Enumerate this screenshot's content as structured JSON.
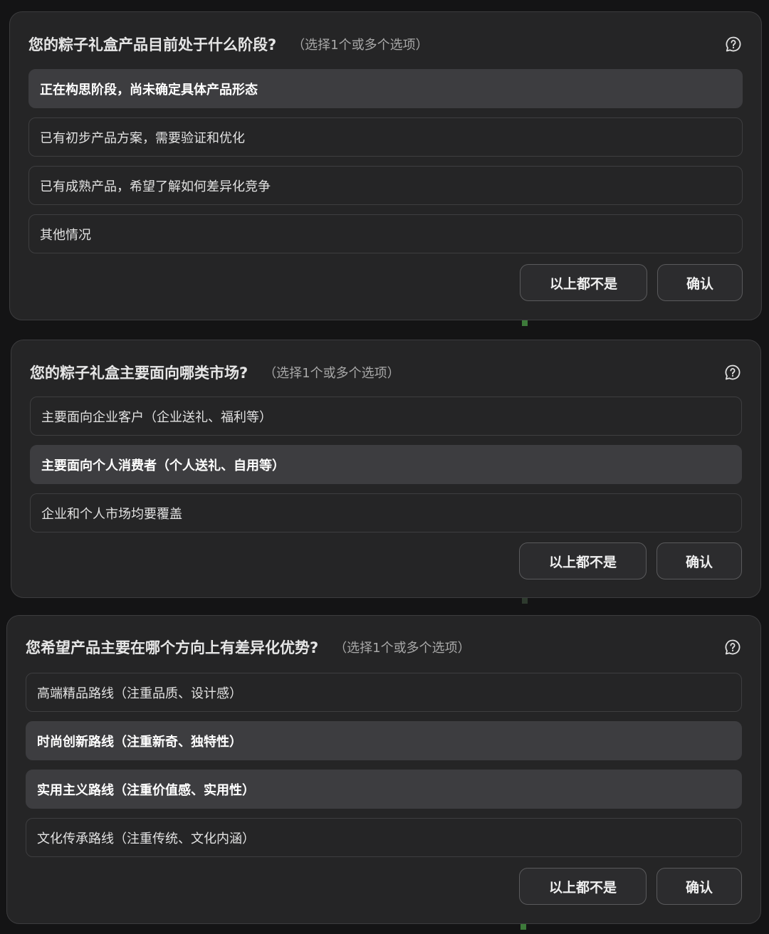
{
  "cards": [
    {
      "title": "您的粽子礼盒产品目前处于什么阶段?",
      "hint": "（选择1个或多个选项）",
      "options": [
        {
          "label": "正在构思阶段，尚未确定具体产品形态",
          "selected": true
        },
        {
          "label": "已有初步产品方案，需要验证和优化",
          "selected": false
        },
        {
          "label": "已有成熟产品，希望了解如何差异化竞争",
          "selected": false
        },
        {
          "label": "其他情况",
          "selected": false
        }
      ],
      "none_label": "以上都不是",
      "confirm_label": "确认"
    },
    {
      "title": "您的粽子礼盒主要面向哪类市场?",
      "hint": "（选择1个或多个选项）",
      "options": [
        {
          "label": "主要面向企业客户（企业送礼、福利等）",
          "selected": false
        },
        {
          "label": "主要面向个人消费者（个人送礼、自用等）",
          "selected": true
        },
        {
          "label": "企业和个人市场均要覆盖",
          "selected": false
        }
      ],
      "none_label": "以上都不是",
      "confirm_label": "确认"
    },
    {
      "title": "您希望产品主要在哪个方向上有差异化优势?",
      "hint": "（选择1个或多个选项）",
      "options": [
        {
          "label": "高端精品路线（注重品质、设计感）",
          "selected": false
        },
        {
          "label": "时尚创新路线（注重新奇、独特性）",
          "selected": true
        },
        {
          "label": "实用主义路线（注重价值感、实用性）",
          "selected": true
        },
        {
          "label": "文化传承路线（注重传统、文化内涵）",
          "selected": false
        }
      ],
      "none_label": "以上都不是",
      "confirm_label": "确认"
    }
  ],
  "icons": {
    "help": "help-chat-icon"
  }
}
